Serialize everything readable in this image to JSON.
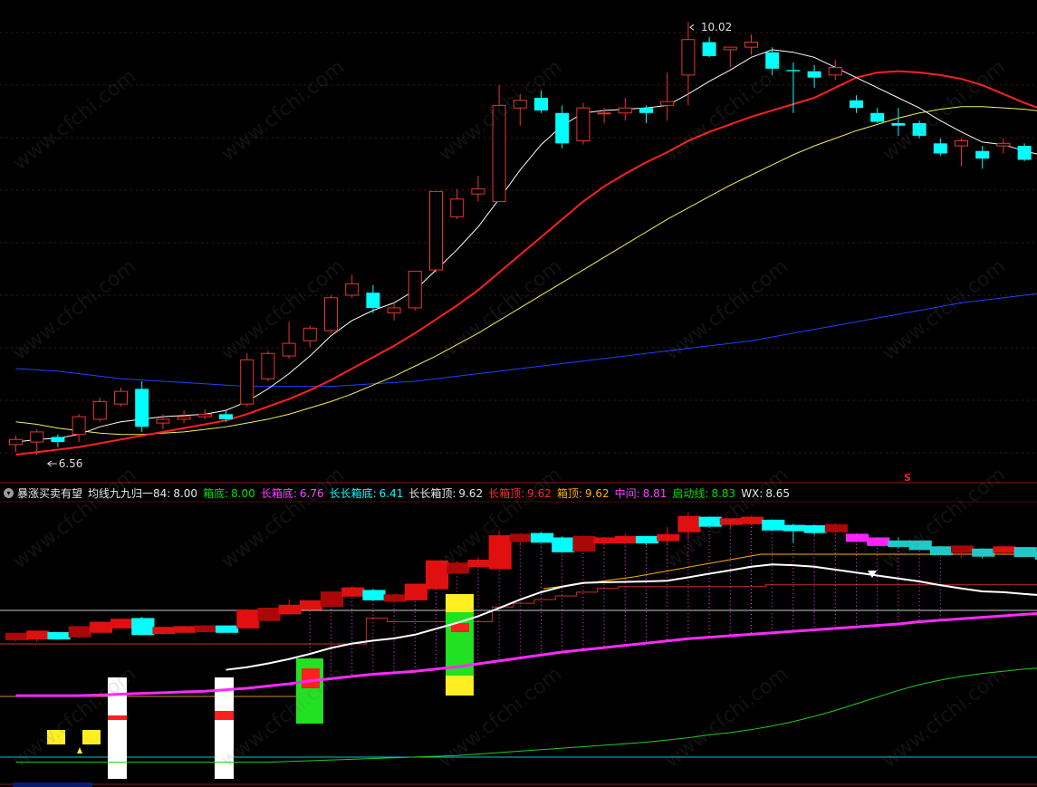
{
  "panel": {
    "indicator_name": "暴涨买卖有望",
    "params": [
      {
        "label": "均线九九归一84:",
        "value": "8.00",
        "color": "#e8e8e8"
      },
      {
        "label": "箱底:",
        "value": "8.00",
        "color": "#00e000"
      },
      {
        "label": "长箱底:",
        "value": "6.76",
        "color": "#ff44ff"
      },
      {
        "label": "长长箱底:",
        "value": "6.41",
        "color": "#00ffff"
      },
      {
        "label": "长长箱顶:",
        "value": "9.62",
        "color": "#e8e8e8"
      },
      {
        "label": "长箱顶:",
        "value": "9.62",
        "color": "#ff2a2a"
      },
      {
        "label": "箱顶:",
        "value": "9.62",
        "color": "#ffb000"
      },
      {
        "label": "中间:",
        "value": "8.81",
        "color": "#ff44ff"
      },
      {
        "label": "启动线:",
        "value": "8.83",
        "color": "#00e000"
      },
      {
        "label": "WX:",
        "value": "8.65",
        "color": "#e8e8e8"
      }
    ]
  },
  "watermark": "www.cfchi.com",
  "chart_data": {
    "type": "candlestick",
    "price_high_label": "10.02",
    "price_low_label": "6.56",
    "sell_marker": "S",
    "colors": {
      "up": "#e8372d",
      "down": "#00ffff",
      "ma5": "#ffffff",
      "ma10": "#ff2020",
      "ma20": "#f0f060",
      "ma60": "#2040ff"
    },
    "candles": [
      [
        6.68,
        6.75,
        6.62,
        6.72
      ],
      [
        6.7,
        6.8,
        6.6,
        6.78
      ],
      [
        6.74,
        6.76,
        6.66,
        6.7
      ],
      [
        6.76,
        6.92,
        6.7,
        6.9
      ],
      [
        6.88,
        7.05,
        6.86,
        7.02
      ],
      [
        7.0,
        7.13,
        6.98,
        7.1
      ],
      [
        7.12,
        7.18,
        6.78,
        6.82
      ],
      [
        6.85,
        6.92,
        6.8,
        6.88
      ],
      [
        6.88,
        6.95,
        6.85,
        6.9
      ],
      [
        6.9,
        6.96,
        6.88,
        6.92
      ],
      [
        6.92,
        6.95,
        6.86,
        6.88
      ],
      [
        7.0,
        7.4,
        6.98,
        7.35
      ],
      [
        7.2,
        7.42,
        7.18,
        7.4
      ],
      [
        7.38,
        7.65,
        7.36,
        7.48
      ],
      [
        7.5,
        7.62,
        7.45,
        7.6
      ],
      [
        7.58,
        7.86,
        7.56,
        7.84
      ],
      [
        7.86,
        8.02,
        7.84,
        7.95
      ],
      [
        7.88,
        7.94,
        7.72,
        7.76
      ],
      [
        7.72,
        7.8,
        7.66,
        7.76
      ],
      [
        7.76,
        8.05,
        7.74,
        8.05
      ],
      [
        8.06,
        8.68,
        8.04,
        8.68
      ],
      [
        8.48,
        8.7,
        8.46,
        8.62
      ],
      [
        8.66,
        8.8,
        8.6,
        8.7
      ],
      [
        8.6,
        9.52,
        8.6,
        9.36
      ],
      [
        9.34,
        9.45,
        9.2,
        9.4
      ],
      [
        9.42,
        9.48,
        9.3,
        9.32
      ],
      [
        9.3,
        9.36,
        9.02,
        9.06
      ],
      [
        9.08,
        9.38,
        9.05,
        9.34
      ],
      [
        9.3,
        9.34,
        9.22,
        9.3
      ],
      [
        9.3,
        9.42,
        9.24,
        9.34
      ],
      [
        9.34,
        9.36,
        9.22,
        9.3
      ],
      [
        9.36,
        9.62,
        9.24,
        9.39
      ],
      [
        9.6,
        10.02,
        9.36,
        9.88
      ],
      [
        9.86,
        9.9,
        9.74,
        9.75
      ],
      [
        9.8,
        9.82,
        9.66,
        9.82
      ],
      [
        9.82,
        9.92,
        9.76,
        9.86
      ],
      [
        9.78,
        9.82,
        9.6,
        9.65
      ],
      [
        9.64,
        9.7,
        9.3,
        9.63
      ],
      [
        9.63,
        9.68,
        9.5,
        9.58
      ],
      [
        9.6,
        9.72,
        9.56,
        9.66
      ],
      [
        9.4,
        9.44,
        9.3,
        9.34
      ],
      [
        9.3,
        9.34,
        9.22,
        9.23
      ],
      [
        9.22,
        9.34,
        9.12,
        9.2
      ],
      [
        9.22,
        9.24,
        9.1,
        9.12
      ],
      [
        9.06,
        9.1,
        8.96,
        8.98
      ],
      [
        9.04,
        9.1,
        8.88,
        9.08
      ],
      [
        9.0,
        9.04,
        8.86,
        8.94
      ],
      [
        9.04,
        9.1,
        8.98,
        9.06
      ],
      [
        9.04,
        9.06,
        8.92,
        8.93
      ],
      [
        8.92,
        8.96,
        8.84,
        8.86
      ]
    ],
    "ma5": [
      6.7,
      6.72,
      6.73,
      6.76,
      6.82,
      6.86,
      6.88,
      6.9,
      6.91,
      6.92,
      6.95,
      7.02,
      7.12,
      7.24,
      7.38,
      7.54,
      7.66,
      7.74,
      7.8,
      7.9,
      8.06,
      8.22,
      8.4,
      8.62,
      8.85,
      9.05,
      9.2,
      9.3,
      9.32,
      9.33,
      9.34,
      9.36,
      9.45,
      9.55,
      9.64,
      9.74,
      9.8,
      9.78,
      9.74,
      9.66,
      9.58,
      9.5,
      9.42,
      9.34,
      9.24,
      9.15,
      9.07,
      9.05,
      9.0,
      8.96
    ],
    "ma10": [
      6.6,
      6.62,
      6.64,
      6.66,
      6.69,
      6.72,
      6.75,
      6.78,
      6.81,
      6.84,
      6.87,
      6.92,
      6.98,
      7.04,
      7.11,
      7.19,
      7.28,
      7.37,
      7.46,
      7.56,
      7.67,
      7.78,
      7.9,
      8.04,
      8.18,
      8.32,
      8.46,
      8.6,
      8.72,
      8.82,
      8.91,
      8.99,
      9.08,
      9.15,
      9.21,
      9.27,
      9.32,
      9.37,
      9.42,
      9.5,
      9.58,
      9.62,
      9.63,
      9.62,
      9.6,
      9.57,
      9.52,
      9.45,
      9.38,
      9.32
    ],
    "ma20": [
      6.86,
      6.84,
      6.81,
      6.79,
      6.77,
      6.76,
      6.76,
      6.77,
      6.78,
      6.8,
      6.82,
      6.85,
      6.88,
      6.92,
      6.97,
      7.02,
      7.08,
      7.15,
      7.22,
      7.3,
      7.38,
      7.47,
      7.56,
      7.66,
      7.76,
      7.86,
      7.96,
      8.06,
      8.16,
      8.26,
      8.36,
      8.46,
      8.55,
      8.64,
      8.73,
      8.81,
      8.89,
      8.97,
      9.04,
      9.1,
      9.16,
      9.21,
      9.26,
      9.3,
      9.33,
      9.35,
      9.35,
      9.34,
      9.33,
      9.31
    ],
    "ma60": [
      7.28,
      7.27,
      7.26,
      7.24,
      7.22,
      7.2,
      7.19,
      7.18,
      7.17,
      7.16,
      7.15,
      7.14,
      7.14,
      7.14,
      7.14,
      7.14,
      7.15,
      7.16,
      7.17,
      7.18,
      7.2,
      7.22,
      7.24,
      7.26,
      7.28,
      7.3,
      7.32,
      7.34,
      7.36,
      7.38,
      7.4,
      7.42,
      7.44,
      7.46,
      7.48,
      7.5,
      7.53,
      7.56,
      7.59,
      7.62,
      7.65,
      7.68,
      7.71,
      7.74,
      7.77,
      7.8,
      7.82,
      7.84,
      7.86,
      7.88
    ],
    "indicator": {
      "zhongjian": [
        5.1,
        5.1,
        5.1,
        5.1,
        5.12,
        5.14,
        5.16,
        5.18,
        5.2,
        5.22,
        5.26,
        5.3,
        5.36,
        5.42,
        5.5,
        5.56,
        5.62,
        5.68,
        5.72,
        5.76,
        5.82,
        5.88,
        5.96,
        6.04,
        6.12,
        6.2,
        6.28,
        6.34,
        6.4,
        6.46,
        6.52,
        6.58,
        6.64,
        6.68,
        6.72,
        6.76,
        6.8,
        6.84,
        6.88,
        6.92,
        6.96,
        7.0,
        7.04,
        7.1,
        7.14,
        7.18,
        7.22,
        7.26,
        7.3,
        7.34
      ],
      "qidongxian": [
        3.3,
        3.3,
        3.3,
        3.3,
        3.3,
        3.3,
        3.3,
        3.3,
        3.3,
        3.3,
        3.3,
        3.3,
        3.3,
        3.32,
        3.34,
        3.36,
        3.38,
        3.4,
        3.42,
        3.44,
        3.46,
        3.48,
        3.52,
        3.56,
        3.6,
        3.64,
        3.68,
        3.72,
        3.76,
        3.8,
        3.84,
        3.9,
        3.96,
        4.04,
        4.1,
        4.18,
        4.28,
        4.4,
        4.54,
        4.7,
        4.88,
        5.06,
        5.24,
        5.4,
        5.52,
        5.62,
        5.7,
        5.76,
        5.82,
        5.86
      ],
      "box_top_step": [
        6.5,
        6.5,
        6.5,
        6.5,
        6.5,
        6.5,
        6.5,
        6.5,
        6.5,
        6.5,
        6.5,
        6.5,
        6.5,
        6.5,
        6.5,
        6.5,
        6.5,
        7.2,
        7.1,
        7.1,
        7.1,
        7.1,
        7.1,
        7.5,
        7.6,
        7.7,
        7.8,
        7.9,
        8.0,
        8.05,
        8.05,
        8.05,
        8.05,
        8.05,
        8.05,
        8.05,
        8.1,
        8.1,
        8.1,
        8.1,
        8.1,
        8.1,
        8.1,
        8.1,
        8.1,
        8.1,
        8.1,
        8.1,
        8.1,
        8.1
      ]
    }
  }
}
